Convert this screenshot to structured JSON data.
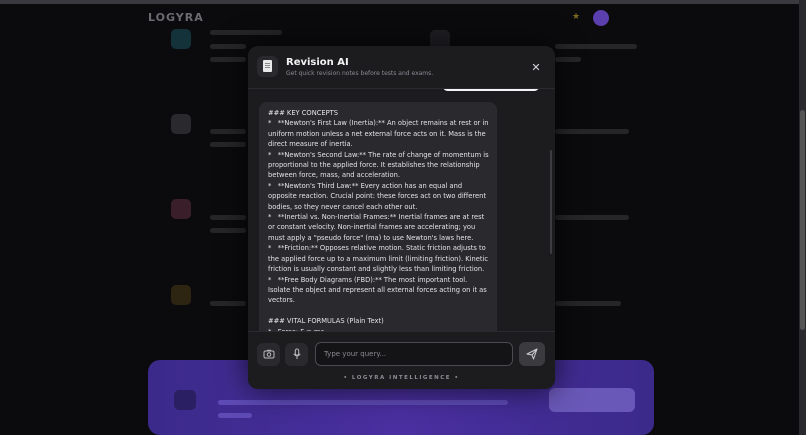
{
  "modal": {
    "title": "Revision AI",
    "subtitle": "Get quick revision notes before tests and exams.",
    "close_glyph": "✕",
    "message_text": "### KEY CONCEPTS\n*   **Newton's First Law (Inertia):** An object remains at rest or in uniform motion unless a net external force acts on it. Mass is the direct measure of inertia.\n*   **Newton's Second Law:** The rate of change of momentum is proportional to the applied force. It establishes the relationship between force, mass, and acceleration.\n*   **Newton's Third Law:** Every action has an equal and opposite reaction. Crucial point: these forces act on two different bodies, so they never cancel each other out.\n*   **Inertial vs. Non-Inertial Frames:** Inertial frames are at rest or constant velocity. Non-inertial frames are accelerating; you must apply a \"pseudo force\" (ma) to use Newton's laws here.\n*   **Friction:** Opposes relative motion. Static friction adjusts to the applied force up to a maximum limit (limiting friction). Kinetic friction is usually constant and slightly less than limiting friction.\n*   **Free Body Diagrams (FBD):** The most important tool. Isolate the object and represent all external forces acting on it as vectors.\n\n### VITAL FORMULAS (Plain Text)\n*   Force: F = ma",
    "composer": {
      "placeholder": "Type your query...",
      "footer": "• LOGYRA INTELLIGENCE •"
    }
  },
  "background": {
    "logo": "LOGYRA"
  },
  "icons": {
    "camera": "camera-icon",
    "mic": "microphone-icon",
    "send": "send-icon",
    "document": "document-icon"
  }
}
